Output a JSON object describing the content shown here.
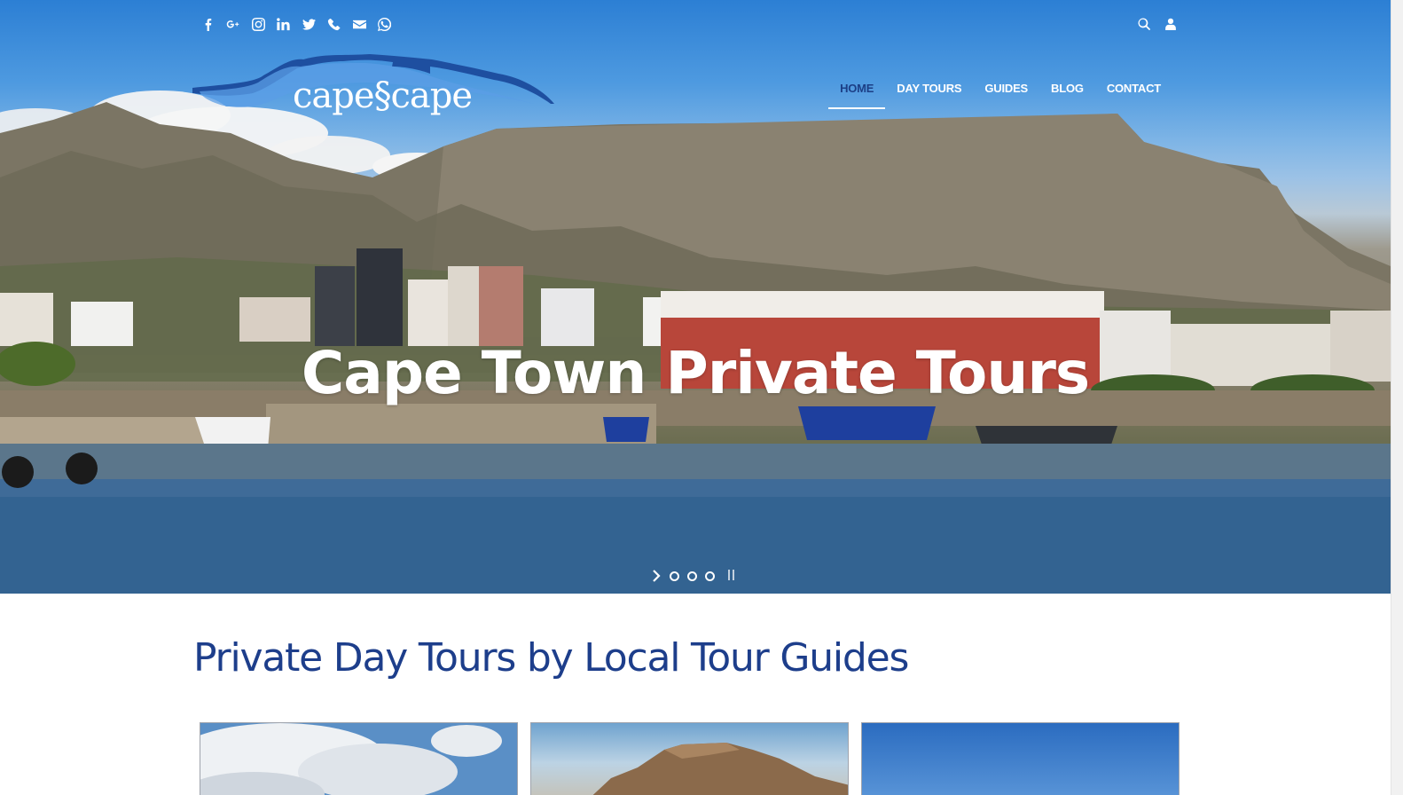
{
  "brand": {
    "name": "cape scape",
    "logo_text": "cape§cape"
  },
  "social_icons": [
    "facebook-icon",
    "google-plus-icon",
    "instagram-icon",
    "linkedin-icon",
    "twitter-icon",
    "phone-icon",
    "envelope-icon",
    "whatsapp-icon"
  ],
  "utility_icons": [
    "search-icon",
    "user-icon"
  ],
  "nav": {
    "items": [
      {
        "label": "HOME",
        "active": true
      },
      {
        "label": "DAY TOURS",
        "active": false
      },
      {
        "label": "GUIDES",
        "active": false
      },
      {
        "label": "BLOG",
        "active": false
      },
      {
        "label": "CONTACT",
        "active": false
      }
    ]
  },
  "hero": {
    "title": "Cape Town Private Tours",
    "slides_count": 3,
    "active_slide": 1
  },
  "section": {
    "title": "Private Day Tours by Local Tour Guides"
  },
  "colors": {
    "brand_blue": "#1d3e8b",
    "nav_active": "#1c3f86",
    "logo_blue": "#1e4fa0"
  }
}
